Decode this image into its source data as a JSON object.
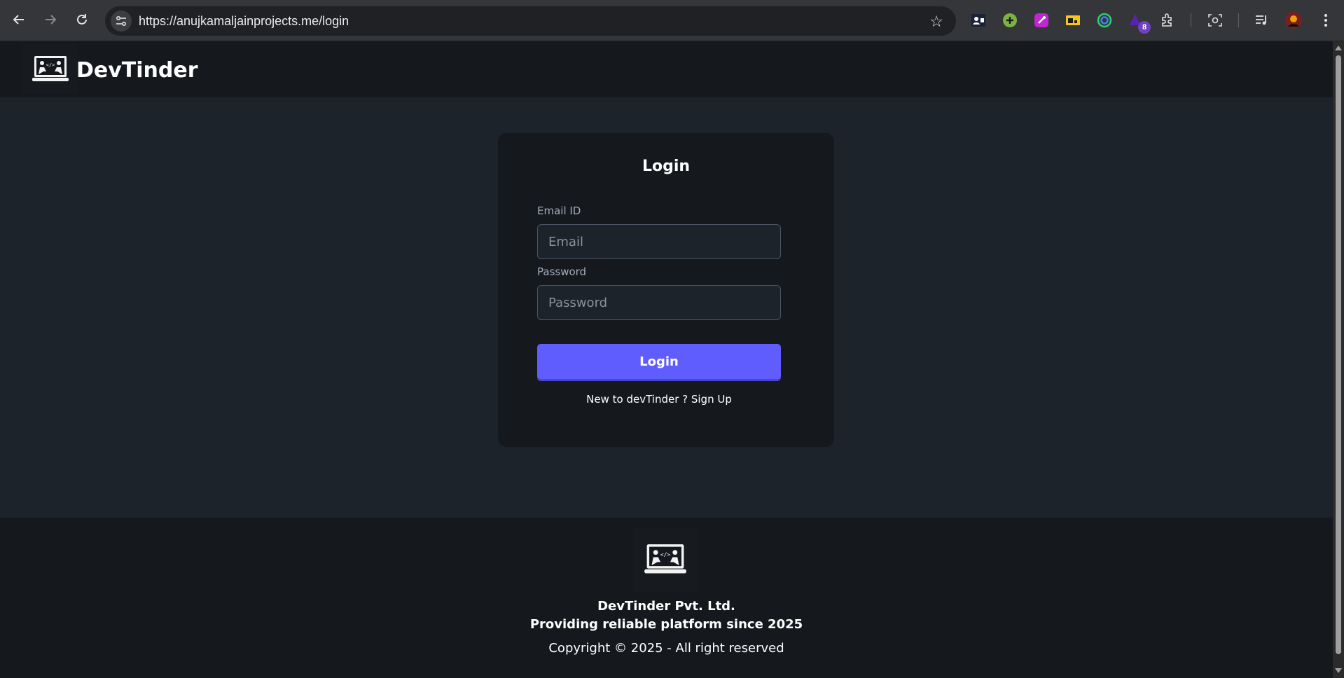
{
  "browser": {
    "url": "https://anujkamaljainprojects.me/login",
    "extension_badge": "8"
  },
  "navbar": {
    "brand": "DevTinder"
  },
  "login": {
    "title": "Login",
    "email_label": "Email ID",
    "email_placeholder": "Email",
    "password_label": "Password",
    "password_placeholder": "Password",
    "button_label": "Login",
    "signup_text": "New to devTinder ? Sign Up"
  },
  "footer": {
    "company": "DevTinder Pvt. Ltd.",
    "tagline": "Providing reliable platform since 2025",
    "copyright": "Copyright © 2025 - All right reserved"
  },
  "colors": {
    "accent": "#605dff",
    "page_bg": "#1d232a",
    "panel_bg": "#15191e"
  }
}
